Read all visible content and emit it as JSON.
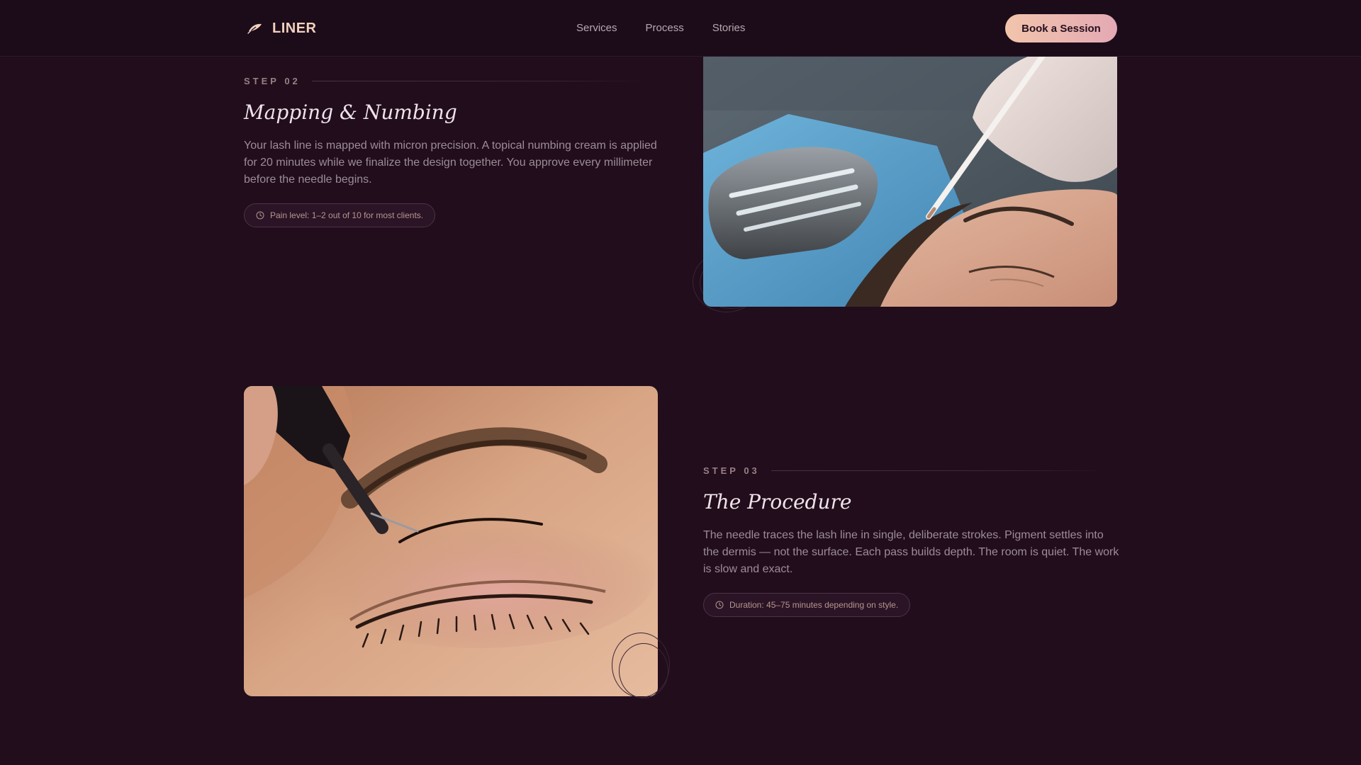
{
  "brand": {
    "name": "LINER",
    "icon": "feather-icon"
  },
  "nav": {
    "items": [
      "Services",
      "Process",
      "Stories"
    ]
  },
  "cta": {
    "label": "Book a Session"
  },
  "steps": [
    {
      "label": "STEP 02",
      "title": "Mapping & Numbing",
      "description": "Your lash line is mapped with micron precision. A topical numbing cream is applied for 20 minutes while we finalize the design together. You approve every millimeter before the needle begins.",
      "note": "Pain level: 1–2 out of 10 for most clients.",
      "note_icon": "clock-icon",
      "image_alt": "Gloved hand mapping the brow line with a white pencil on a reclining client"
    },
    {
      "label": "STEP 03",
      "title": "The Procedure",
      "description": "The needle traces the lash line in single, deliberate strokes. Pigment settles into the dermis — not the surface. Each pass builds depth. The room is quiet. The work is slow and exact.",
      "note": "Duration: 45–75 minutes depending on style.",
      "note_icon": "clock-icon",
      "image_alt": "Close-up of a tattoo needle drawing a fine liner stroke above a closed eye"
    }
  ],
  "colors": {
    "background": "#210d1c",
    "accent": "#f2c4ab",
    "accent_pink": "#e4a9b4",
    "text_muted": "#9d8c97"
  }
}
